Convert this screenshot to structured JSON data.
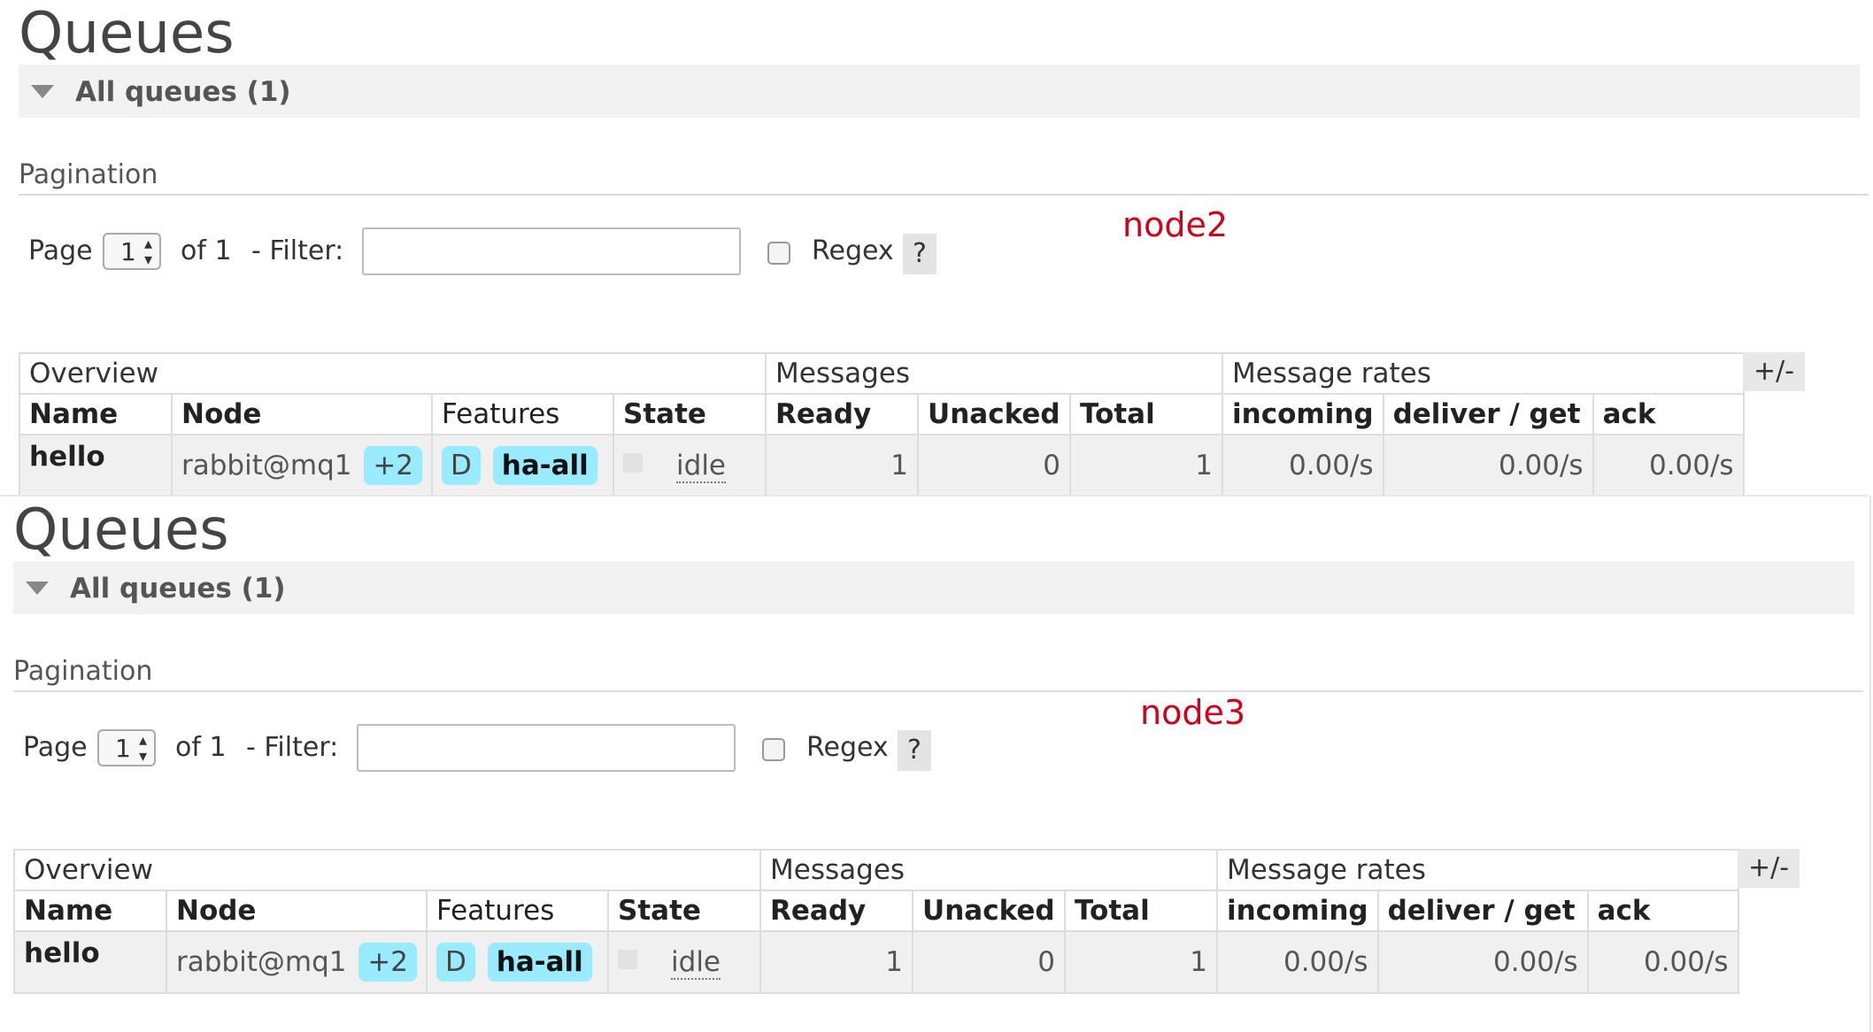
{
  "panels": [
    {
      "title": "Queues",
      "section_label": "All queues (1)",
      "pagination_label": "Pagination",
      "page_label": "Page",
      "page_value": "1",
      "of_label": "of 1",
      "filter_label": "- Filter:",
      "filter_value": "",
      "regex_label": "Regex",
      "help_label": "?",
      "node_note": "node2",
      "toggle_columns_label": "+/-",
      "table": {
        "groups": [
          "Overview",
          "Messages",
          "Message rates"
        ],
        "columns": [
          "Name",
          "Node",
          "Features",
          "State",
          "Ready",
          "Unacked",
          "Total",
          "incoming",
          "deliver / get",
          "ack"
        ],
        "rows": [
          {
            "name": "hello",
            "node": "rabbit@mq1",
            "node_badge": "+2",
            "features": [
              "D",
              "ha-all"
            ],
            "state": "idle",
            "ready": "1",
            "unacked": "0",
            "total": "1",
            "incoming": "0.00/s",
            "deliver_get": "0.00/s",
            "ack": "0.00/s"
          }
        ]
      }
    },
    {
      "title": "Queues",
      "section_label": "All queues (1)",
      "pagination_label": "Pagination",
      "page_label": "Page",
      "page_value": "1",
      "of_label": "of 1",
      "filter_label": "- Filter:",
      "filter_value": "",
      "regex_label": "Regex",
      "help_label": "?",
      "node_note": "node3",
      "toggle_columns_label": "+/-",
      "table": {
        "groups": [
          "Overview",
          "Messages",
          "Message rates"
        ],
        "columns": [
          "Name",
          "Node",
          "Features",
          "State",
          "Ready",
          "Unacked",
          "Total",
          "incoming",
          "deliver / get",
          "ack"
        ],
        "rows": [
          {
            "name": "hello",
            "node": "rabbit@mq1",
            "node_badge": "+2",
            "features": [
              "D",
              "ha-all"
            ],
            "state": "idle",
            "ready": "1",
            "unacked": "0",
            "total": "1",
            "incoming": "0.00/s",
            "deliver_get": "0.00/s",
            "ack": "0.00/s"
          }
        ]
      }
    }
  ],
  "colors": {
    "badge": "#99ebff",
    "note": "#d0021b",
    "row_bg": "#f0f0f0"
  }
}
